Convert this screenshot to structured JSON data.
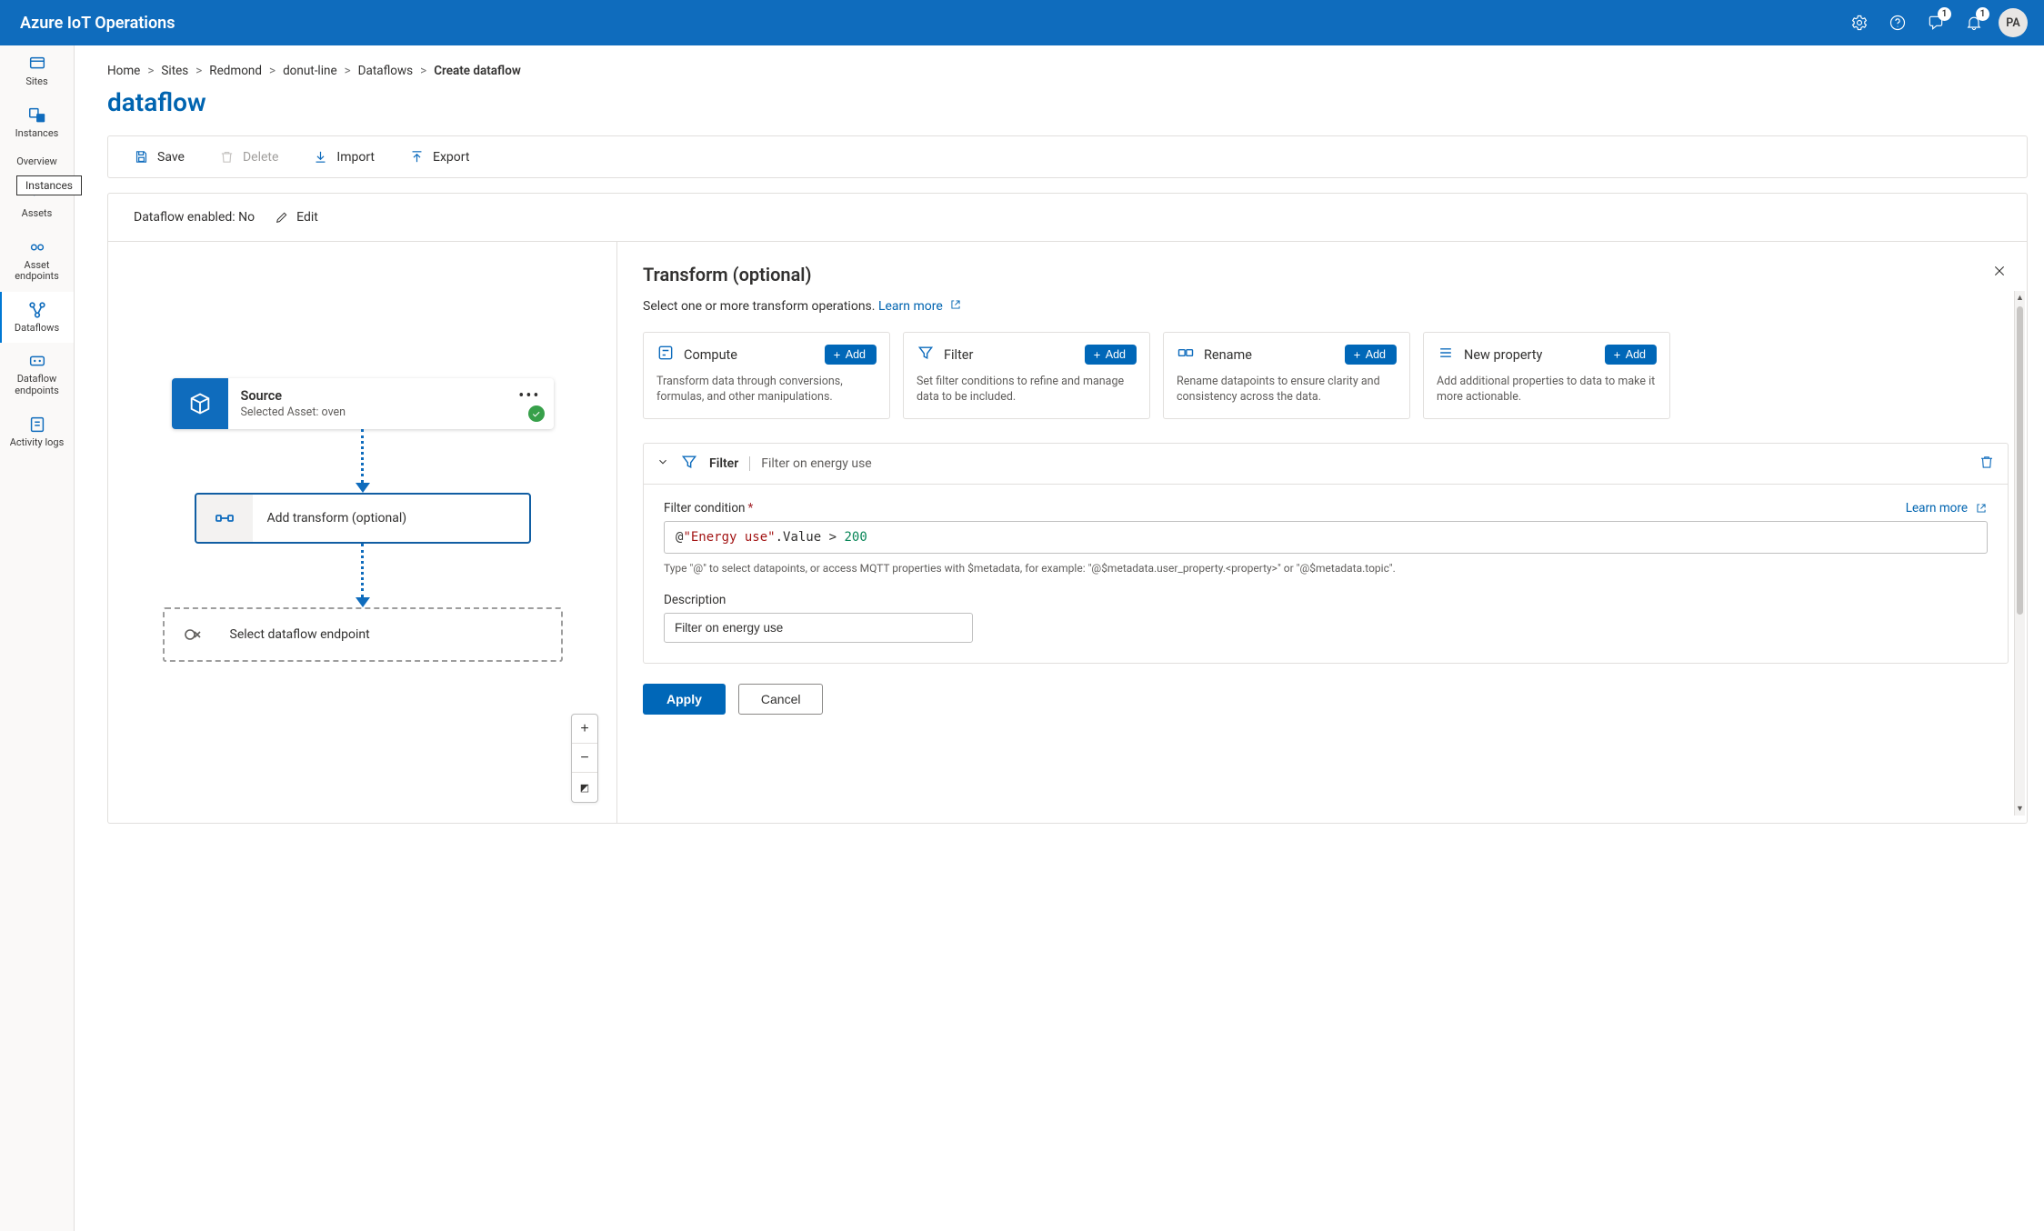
{
  "header": {
    "brand": "Azure IoT Operations",
    "notify_badge": "1",
    "bell_badge": "1",
    "avatar": "PA"
  },
  "rail": {
    "items": [
      {
        "label": "Sites"
      },
      {
        "label": "Instances"
      },
      {
        "label": "Overview"
      },
      {
        "label": "Assets"
      },
      {
        "label": "Asset endpoints"
      },
      {
        "label": "Dataflows"
      },
      {
        "label": "Dataflow endpoints"
      },
      {
        "label": "Activity logs"
      }
    ],
    "tooltip": "Instances"
  },
  "breadcrumbs": [
    "Home",
    "Sites",
    "Redmond",
    "donut-line",
    "Dataflows",
    "Create dataflow"
  ],
  "page_title": "dataflow",
  "toolbar": {
    "save": "Save",
    "delete": "Delete",
    "import": "Import",
    "export": "Export"
  },
  "status": {
    "text": "Dataflow enabled: No",
    "edit": "Edit"
  },
  "canvas": {
    "source": {
      "title": "Source",
      "sub": "Selected Asset: oven"
    },
    "transform": {
      "title": "Add transform (optional)"
    },
    "endpoint": {
      "title": "Select dataflow endpoint"
    }
  },
  "transform_panel": {
    "title": "Transform (optional)",
    "subtitle": "Select one or more transform operations.",
    "learn_more": "Learn more",
    "ops": {
      "compute": {
        "name": "Compute",
        "add": "Add",
        "desc": "Transform data through conversions, formulas, and other manipulations."
      },
      "filter": {
        "name": "Filter",
        "add": "Add",
        "desc": "Set filter conditions to refine and manage data to be included."
      },
      "rename": {
        "name": "Rename",
        "add": "Add",
        "desc": "Rename datapoints to ensure clarity and consistency across the data."
      },
      "new_property": {
        "name": "New property",
        "add": "Add",
        "desc": "Add additional properties to data to make it more actionable."
      }
    },
    "filter_row": {
      "name": "Filter",
      "desc": "Filter on energy use"
    },
    "filter_form": {
      "condition_label": "Filter condition",
      "learn_more": "Learn more",
      "condition_code": {
        "at": "@",
        "str": "\"Energy use\"",
        "prop": ".Value",
        "op": " > ",
        "num": "200"
      },
      "condition_help": "Type \"@\" to select datapoints, or access MQTT properties with $metadata, for example: \"@$metadata.user_property.<property>\" or \"@$metadata.topic\".",
      "description_label": "Description",
      "description_value": "Filter on energy use"
    },
    "actions": {
      "apply": "Apply",
      "cancel": "Cancel"
    }
  }
}
